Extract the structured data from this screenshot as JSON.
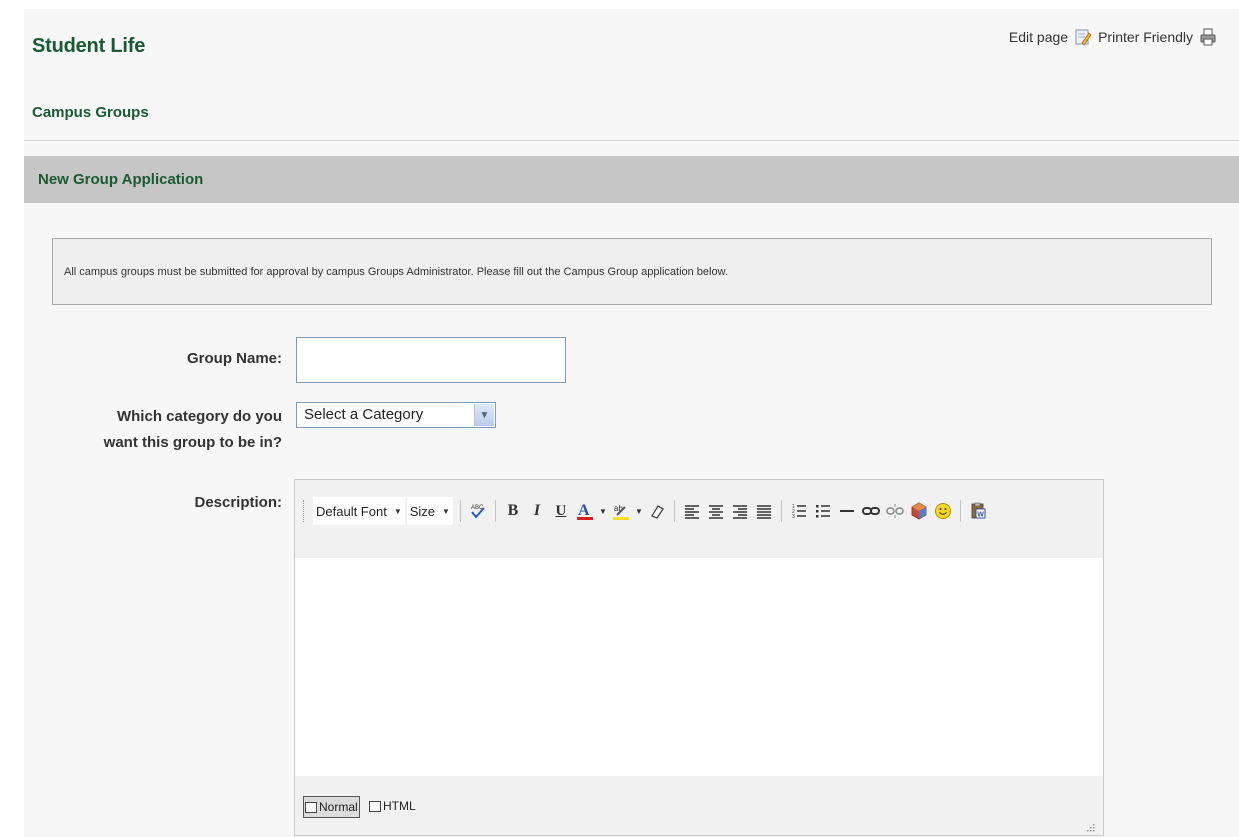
{
  "header": {
    "title": "Student Life",
    "edit_page": "Edit page",
    "printer_friendly": "Printer Friendly",
    "subtitle": "Campus Groups"
  },
  "section": {
    "title": "New Group Application"
  },
  "notice": {
    "text": "All campus groups must be submitted for approval by campus Groups Administrator. Please fill out the Campus Group application below."
  },
  "form": {
    "group_name_label": "Group Name:",
    "group_name_value": "",
    "category_label_line1": "Which category do you",
    "category_label_line2": "want this group to be in?",
    "category_selected": "Select a Category",
    "description_label": "Description:"
  },
  "editor": {
    "font_dropdown": "Default Font",
    "size_dropdown": "Size",
    "mode_normal": "Normal",
    "mode_html": "HTML"
  },
  "colors": {
    "heading_green": "#1a5a32",
    "section_bar": "#c6c6c6",
    "input_border": "#7f9db9"
  }
}
